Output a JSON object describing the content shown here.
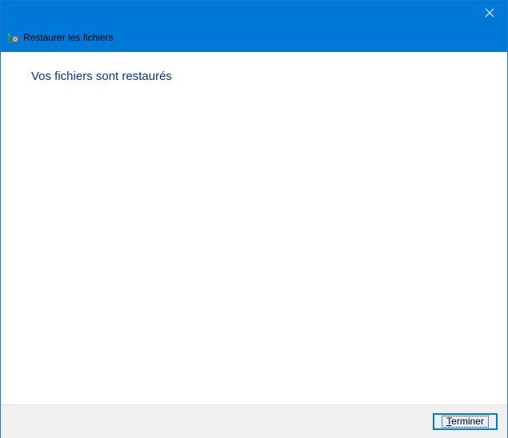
{
  "window": {
    "title": "Restaurer les fichiers",
    "close_icon": "close-icon",
    "app_icon": "restore-files-icon"
  },
  "main": {
    "heading": "Vos fichiers sont restaurés"
  },
  "footer": {
    "finish_button": {
      "accel": "T",
      "rest": "erminer"
    }
  },
  "colors": {
    "titlebar": "#0078d7",
    "heading": "#003399",
    "footer": "#f0f0f0",
    "button_border": "#0078d7",
    "button_fill": "#e5f1fb"
  }
}
